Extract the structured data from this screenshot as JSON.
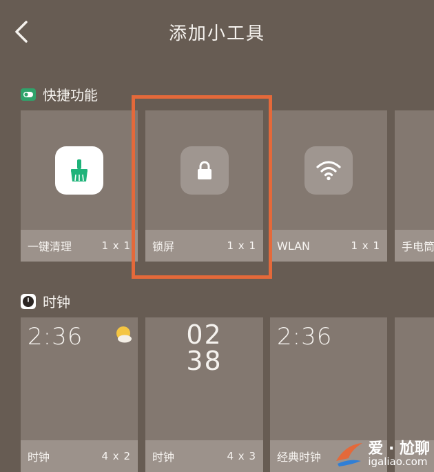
{
  "header": {
    "title": "添加小工具",
    "back_icon": "chevron-left-icon"
  },
  "sections": {
    "shortcuts": {
      "title": "快捷功能",
      "icon": "toggle-switch-icon",
      "icon_color": "#2fa36b",
      "tiles": [
        {
          "label": "一键清理",
          "size": "1 x 1",
          "icon": "broom-icon"
        },
        {
          "label": "锁屏",
          "size": "1 x 1",
          "icon": "lock-icon"
        },
        {
          "label": "WLAN",
          "size": "1 x 1",
          "icon": "wifi-icon"
        },
        {
          "label": "手电筒",
          "size": "",
          "icon": ""
        }
      ]
    },
    "clocks": {
      "title": "时钟",
      "icon": "clock-icon",
      "tiles": [
        {
          "label": "时钟",
          "size": "4 x 2",
          "time": "2:36",
          "icon": "sun-cloud-icon"
        },
        {
          "label": "时钟",
          "size": "4 x 3",
          "hour": "02",
          "minute": "38"
        },
        {
          "label": "经典时钟",
          "size": "",
          "time": "2:36"
        },
        {
          "label": "",
          "size": ""
        }
      ]
    }
  },
  "watermark": {
    "text": "爱 · 尬聊",
    "url": "igaliao.com"
  },
  "colors": {
    "background": "#675c53",
    "tile": "#837870",
    "tile_footer": "#9c928b",
    "highlight": "#e4693a",
    "clean_icon": "#1fb37a"
  }
}
